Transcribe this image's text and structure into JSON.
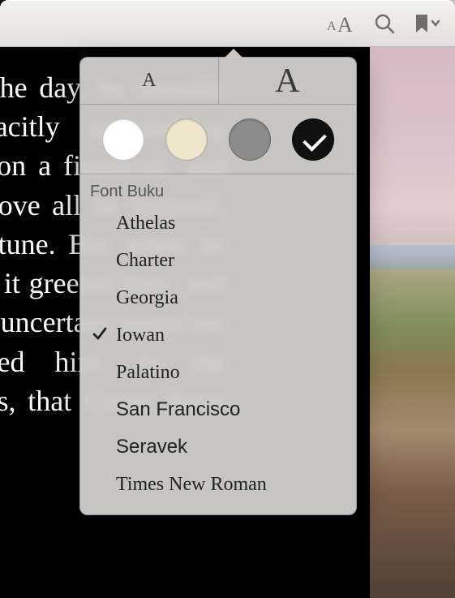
{
  "toolbar": {
    "appearance_icon": "appearance-icon",
    "search_icon": "search-icon",
    "bookmark_icon": "bookmark-icon"
  },
  "reader": {
    "visible_text": "ionary and of the spirit of the day, he heartily cursed Hydraarov, but tacitly undertaking promptly to put the affairs on a financial, and free-trade basis. All, and above all he himself, had made the minister's fortune. But when he came near, and the populace it greeted him, and acclaimed, and shouted. The uncertain suspicion of politic shift embittered him. In the unsatisfactory state of things, that Count Reist—"
  },
  "popover": {
    "size_small_label": "A",
    "size_large_label": "A",
    "themes": [
      {
        "name": "white",
        "selected": false
      },
      {
        "name": "sepia",
        "selected": false
      },
      {
        "name": "gray",
        "selected": false
      },
      {
        "name": "black",
        "selected": true
      }
    ],
    "font_section_label": "Font Buku",
    "fonts": [
      {
        "label": "Athelas",
        "css": "ff-athelas",
        "selected": false
      },
      {
        "label": "Charter",
        "css": "ff-charter",
        "selected": false
      },
      {
        "label": "Georgia",
        "css": "ff-georgia",
        "selected": false
      },
      {
        "label": "Iowan",
        "css": "ff-iowan",
        "selected": true
      },
      {
        "label": "Palatino",
        "css": "ff-palatino",
        "selected": false
      },
      {
        "label": "San Francisco",
        "css": "ff-sanfran",
        "selected": false
      },
      {
        "label": "Seravek",
        "css": "ff-seravek",
        "selected": false
      },
      {
        "label": "Times New Roman",
        "css": "ff-times",
        "selected": false
      }
    ]
  }
}
